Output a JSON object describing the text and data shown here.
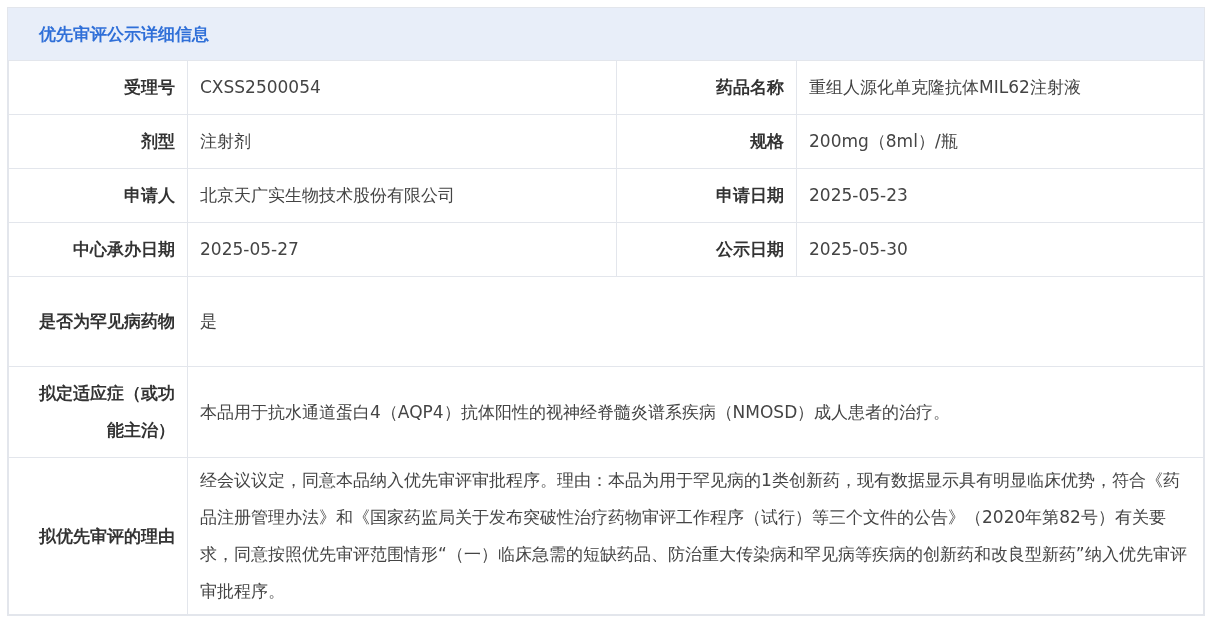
{
  "panel": {
    "title": "优先审评公示详细信息"
  },
  "rows": [
    {
      "fields": [
        {
          "label": "受理号",
          "value": "CXSS2500054"
        },
        {
          "label": "药品名称",
          "value": "重组人源化单克隆抗体MIL62注射液"
        }
      ]
    },
    {
      "fields": [
        {
          "label": "剂型",
          "value": "注射剂"
        },
        {
          "label": "规格",
          "value": "200mg（8ml）/瓶"
        }
      ]
    },
    {
      "fields": [
        {
          "label": "申请人",
          "value": "北京天广实生物技术股份有限公司"
        },
        {
          "label": "申请日期",
          "value": "2025-05-23"
        }
      ]
    },
    {
      "fields": [
        {
          "label": "中心承办日期",
          "value": "2025-05-27"
        },
        {
          "label": "公示日期",
          "value": "2025-05-30"
        }
      ]
    },
    {
      "fields": [
        {
          "label": "是否为罕见病药物",
          "value": "是"
        }
      ]
    },
    {
      "fields": [
        {
          "label": "拟定适应症（或功能主治）",
          "value": "本品用于抗水通道蛋白4（AQP4）抗体阳性的视神经脊髓炎谱系疾病（NMOSD）成人患者的治疗。"
        }
      ]
    },
    {
      "fields": [
        {
          "label": "拟优先审评的理由",
          "value": "经会议议定，同意本品纳入优先审评审批程序。理由：本品为用于罕见病的1类创新药，现有数据显示具有明显临床优势，符合《药品注册管理办法》和《国家药监局关于发布突破性治疗药物审评工作程序（试行）等三个文件的公告》（2020年第82号）有关要求，同意按照优先审评范围情形“（一）临床急需的短缺药品、防治重大传染病和罕见病等疾病的创新药和改良型新药”纳入优先审评审批程序。"
        }
      ]
    }
  ]
}
